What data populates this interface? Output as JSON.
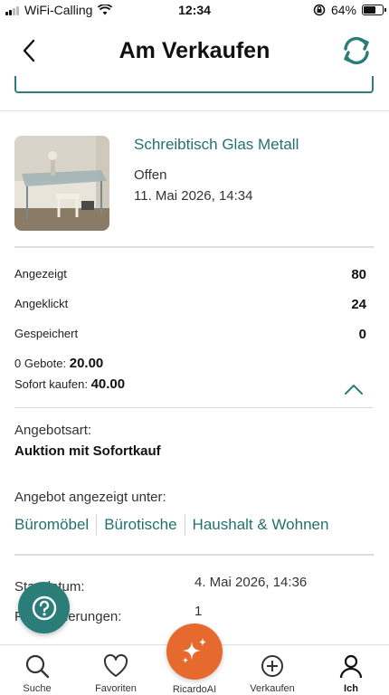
{
  "status_bar": {
    "carrier": "WiFi-Calling",
    "time": "12:34",
    "battery": "64%",
    "battery_level": 0.64
  },
  "header": {
    "title": "Am Verkaufen",
    "back_icon": "chevron-left-icon",
    "refresh_icon": "refresh-icon"
  },
  "listing": {
    "title": "Schreibtisch Glas Metall",
    "status": "Offen",
    "date": "11. Mai 2026, 14:34"
  },
  "stats": {
    "viewed_label": "Angezeigt",
    "viewed_value": "80",
    "clicked_label": "Angeklickt",
    "clicked_value": "24",
    "saved_label": "Gespeichert",
    "saved_value": "0"
  },
  "bids": {
    "bids_label": "0 Gebote:",
    "bids_value": "20.00",
    "buynow_label": "Sofort kaufen:",
    "buynow_value": "40.00"
  },
  "offer_type": {
    "label": "Angebotsart:",
    "value": "Auktion mit Sofortkauf"
  },
  "categories": {
    "label": "Angebot angezeigt unter:",
    "items": [
      "Büromöbel",
      "Bürotische",
      "Haushalt & Wohnen"
    ]
  },
  "details": {
    "start_label": "Startdatum:",
    "start_value": "4. Mai 2026, 14:36",
    "changes_label": "Preisänderungen:",
    "changes_value": "1"
  },
  "nav": {
    "search": "Suche",
    "favorites": "Favoriten",
    "ai": "RicardoAI",
    "sell": "Verkaufen",
    "me": "Ich"
  },
  "colors": {
    "accent": "#2b7d79",
    "ai_orange": "#e66a2e"
  }
}
